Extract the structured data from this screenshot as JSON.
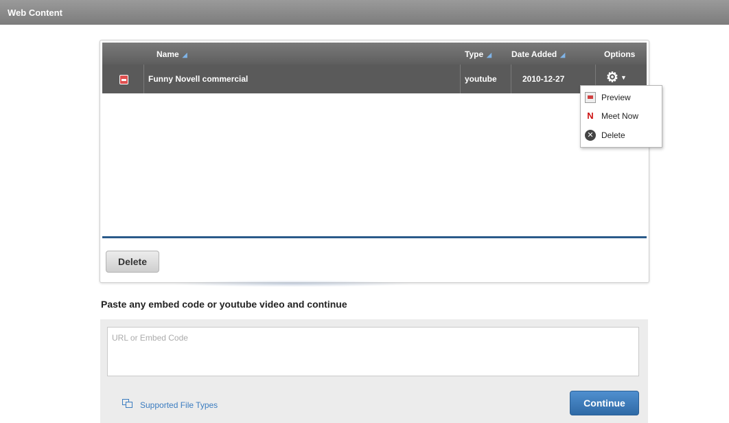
{
  "titlebar": {
    "title": "Web Content"
  },
  "table": {
    "columns": {
      "name": "Name",
      "type": "Type",
      "date_added": "Date Added",
      "options": "Options"
    },
    "rows": [
      {
        "name": "Funny Novell commercial",
        "type": "youtube",
        "date_added": "2010-12-27"
      }
    ]
  },
  "options_menu": {
    "items": [
      {
        "label": "Preview",
        "icon": "preview-icon"
      },
      {
        "label": "Meet Now",
        "icon": "meet-now-icon"
      },
      {
        "label": "Delete",
        "icon": "delete-icon"
      }
    ]
  },
  "panel": {
    "delete_label": "Delete"
  },
  "paste": {
    "heading": "Paste any embed code or youtube video and continue",
    "placeholder": "URL or Embed Code",
    "supported_link": "Supported File Types",
    "continue_label": "Continue"
  }
}
